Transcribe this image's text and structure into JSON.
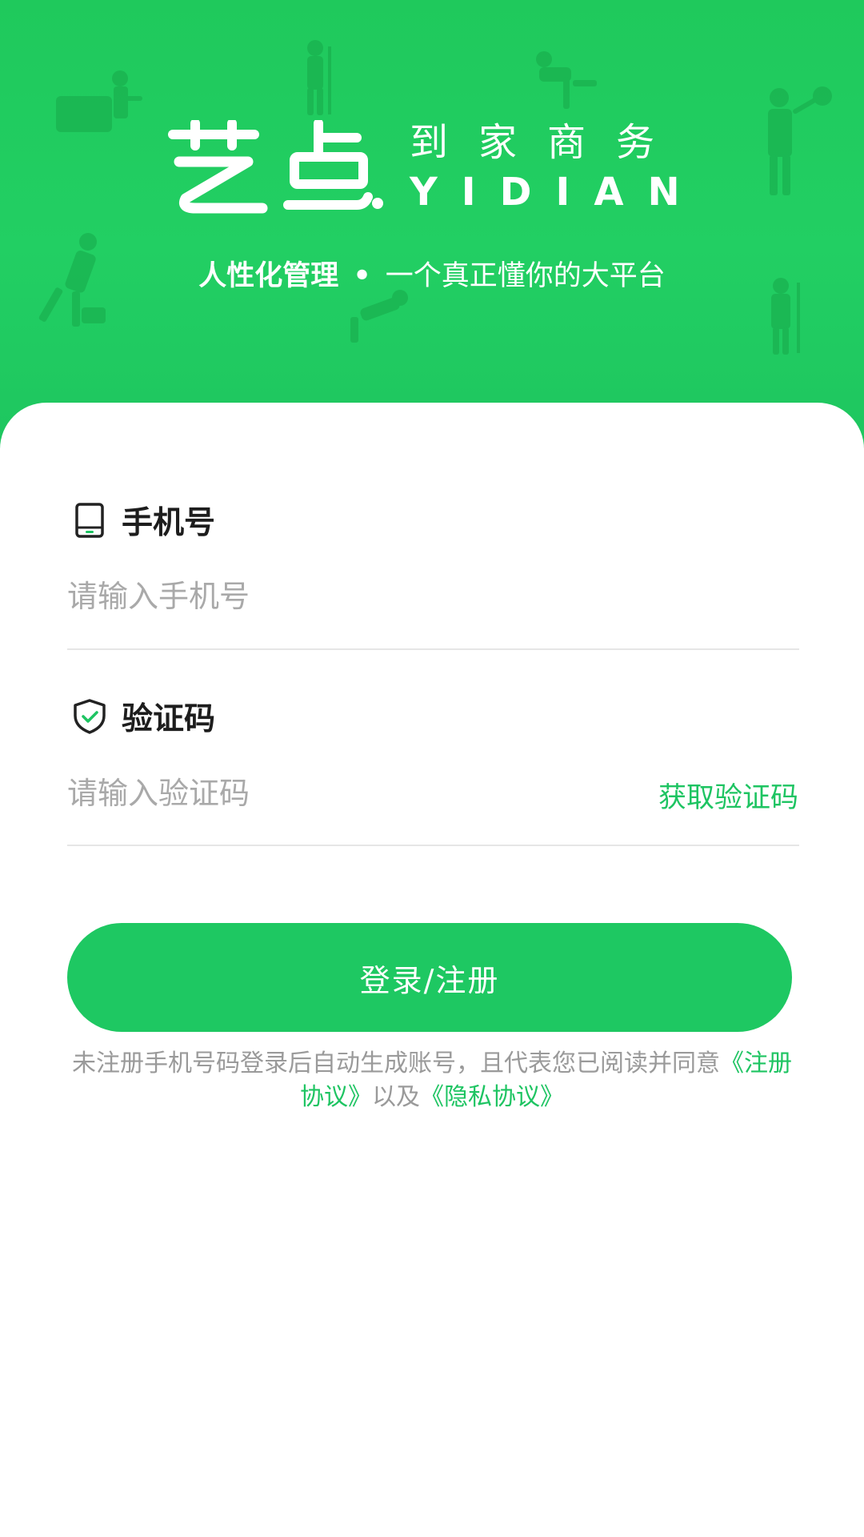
{
  "header": {
    "logo_text": "艺点",
    "tagline_cn": "到家商务",
    "tagline_en": "YIDIAN",
    "slogan_bold": "人性化管理",
    "slogan_dot": "•",
    "slogan_rest": "一个真正懂你的大平台"
  },
  "form": {
    "phone": {
      "label": "手机号",
      "placeholder": "请输入手机号",
      "icon": "phone-icon"
    },
    "code": {
      "label": "验证码",
      "placeholder": "请输入验证码",
      "icon": "shield-check-icon",
      "get_code_label": "获取验证码"
    },
    "login_label": "登录/注册"
  },
  "agreement": {
    "text_1": "未注册手机号码登录后自动生成账号，且代表您已阅读并同意",
    "link_1": "《注册协议》",
    "text_2": "以及",
    "link_2": "《隐私协议》"
  },
  "colors": {
    "brand_green": "#1ec862",
    "link_green": "#1ec462",
    "placeholder_gray": "#a9a9a9",
    "divider_gray": "#e6e6e6"
  }
}
